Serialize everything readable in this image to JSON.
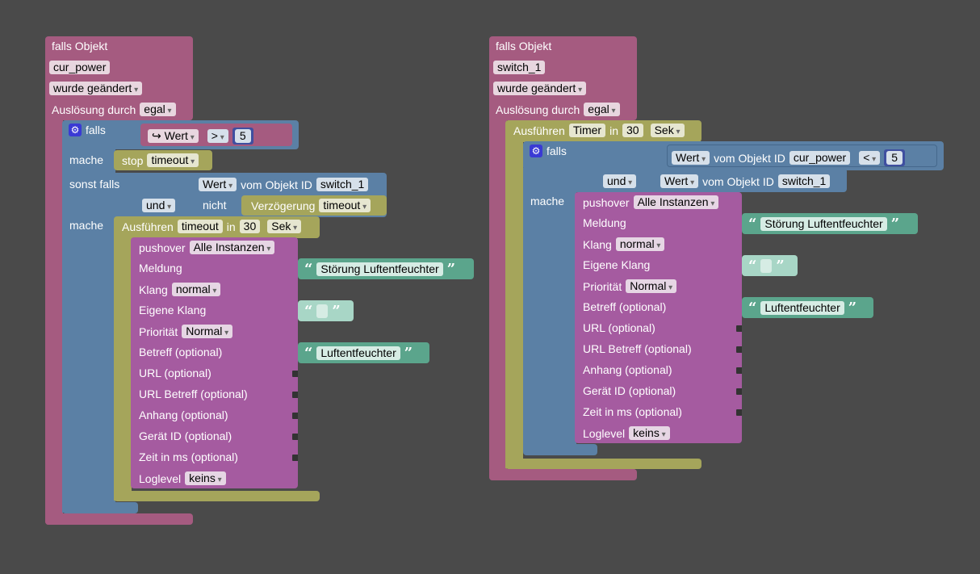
{
  "left": {
    "falls_objekt": "falls Objekt",
    "object_id": "cur_power",
    "trigger": "wurde geändert",
    "ausloesung": "Auslösung durch",
    "ausloesung_val": "egal",
    "if_falls": "falls",
    "cond_val": "Wert",
    "cond_op": ">",
    "cond_num": "5",
    "mache1": "mache",
    "stop": "stop",
    "stop_val": "timeout",
    "sonst_falls": "sonst falls",
    "sf_wert": "Wert",
    "sf_vom": "vom Objekt ID",
    "sf_obj": "switch_1",
    "sf_und": "und",
    "sf_nicht": "nicht",
    "sf_verz": "Verzögerung",
    "sf_timeout": "timeout",
    "mache2": "mache",
    "ausfuehren": "Ausführen",
    "timer_name": "timeout",
    "in": "in",
    "timer_num": "30",
    "timer_unit": "Sek",
    "pushover": {
      "title": "pushover",
      "instance": "Alle Instanzen",
      "meldung": "Meldung",
      "meldung_text": "Störung Luftentfeuchter",
      "klang": "Klang",
      "klang_val": "normal",
      "eigene_klang": "Eigene Klang",
      "prio": "Priorität",
      "prio_val": "Normal",
      "betreff": "Betreff (optional)",
      "betreff_text": "Luftentfeuchter",
      "url": "URL (optional)",
      "url_betreff": "URL Betreff (optional)",
      "anhang": "Anhang (optional)",
      "geraet": "Gerät ID (optional)",
      "zeit": "Zeit in ms (optional)",
      "loglevel": "Loglevel",
      "loglevel_val": "keins"
    }
  },
  "right": {
    "falls_objekt": "falls Objekt",
    "object_id": "switch_1",
    "trigger": "wurde geändert",
    "ausloesung": "Auslösung durch",
    "ausloesung_val": "egal",
    "ausfuehren": "Ausführen",
    "timer_name": "Timer",
    "in": "in",
    "timer_num": "30",
    "timer_unit": "Sek",
    "if_falls": "falls",
    "c1_wert": "Wert",
    "c1_vom": "vom Objekt ID",
    "c1_obj": "cur_power",
    "c1_op": "<",
    "c1_num": "5",
    "c2_und": "und",
    "c2_wert": "Wert",
    "c2_vom": "vom Objekt ID",
    "c2_obj": "switch_1",
    "mache": "mache",
    "pushover": {
      "title": "pushover",
      "instance": "Alle Instanzen",
      "meldung": "Meldung",
      "meldung_text": "Störung Luftentfeuchter",
      "klang": "Klang",
      "klang_val": "normal",
      "eigene_klang": "Eigene Klang",
      "prio": "Priorität",
      "prio_val": "Normal",
      "betreff": "Betreff (optional)",
      "betreff_text": "Luftentfeuchter",
      "url": "URL (optional)",
      "url_betreff": "URL Betreff (optional)",
      "anhang": "Anhang (optional)",
      "geraet": "Gerät ID (optional)",
      "zeit": "Zeit in ms (optional)",
      "loglevel": "Loglevel",
      "loglevel_val": "keins"
    }
  },
  "colors": {
    "background": "#4a4a4a",
    "event": "#a55b80",
    "control": "#5b80a5",
    "timer": "#a5a55b",
    "pushover": "#a55ba0",
    "text": "#5ba58c"
  }
}
